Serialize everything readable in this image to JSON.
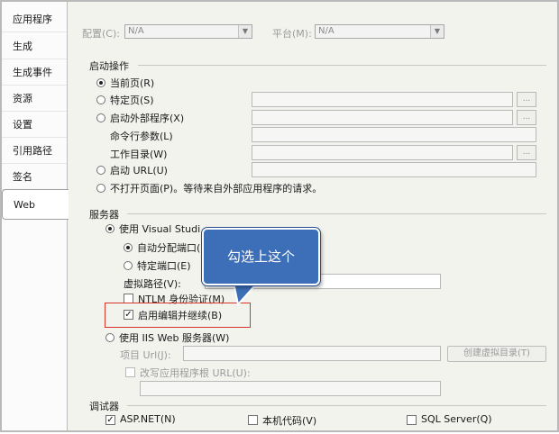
{
  "sidebar": {
    "tabs": [
      "应用程序",
      "生成",
      "生成事件",
      "资源",
      "设置",
      "引用路径",
      "签名",
      "Web"
    ],
    "active": "Web"
  },
  "top": {
    "config_label": "配置(C):",
    "config_value": "N/A",
    "platform_label": "平台(M):",
    "platform_value": "N/A"
  },
  "startup": {
    "title": "启动操作",
    "current_page": "当前页(R)",
    "specific_page": "特定页(S)",
    "start_external": "启动外部程序(X)",
    "cmd_args": "命令行参数(L)",
    "working_dir": "工作目录(W)",
    "start_url": "启动 URL(U)",
    "dont_open": "不打开页面(P)。等待来自外部应用程序的请求。",
    "browse_label": "..."
  },
  "servers": {
    "title": "服务器",
    "use_vs": "使用 Visual Studi",
    "auto_port": "自动分配端口(",
    "specific_port": "特定端口(E)",
    "virtual_path": "虚拟路径(V):",
    "ntlm": "NTLM 身份验证(M)",
    "edit_continue": "启用编辑并继续(B)",
    "use_iis": "使用 IIS Web 服务器(W)",
    "project_url": "项目 Url(J):",
    "create_vdir": "创建虚拟目录(T)",
    "override_root": "改写应用程序根 URL(U):"
  },
  "debuggers": {
    "title": "调试器",
    "aspnet": "ASP.NET(N)",
    "native": "本机代码(V)",
    "sql": "SQL Server(Q)"
  },
  "callout": {
    "text": "勾选上这个",
    "color": "#3d6fb8"
  },
  "highlight_color": "#d9342b"
}
